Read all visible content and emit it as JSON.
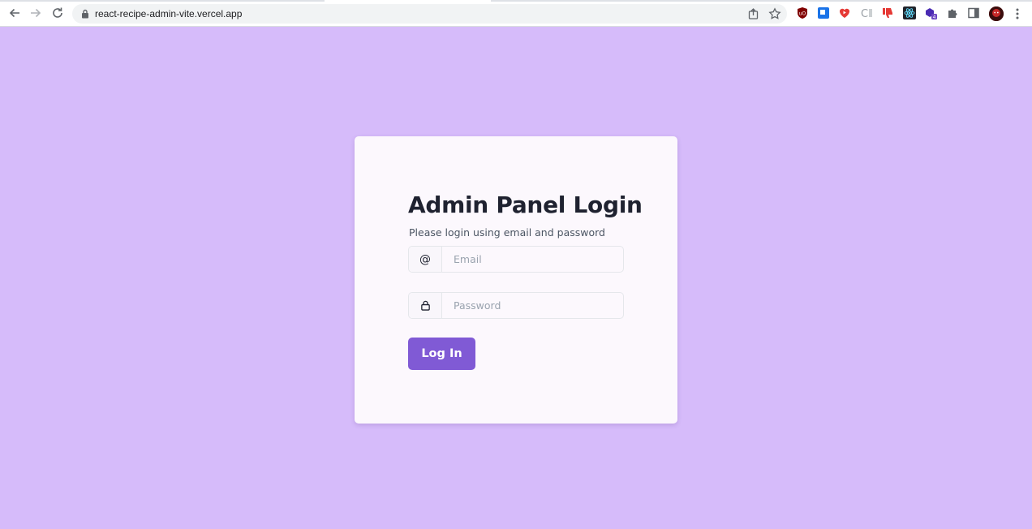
{
  "browser": {
    "url": "react-recipe-admin-vite.vercel.app"
  },
  "login": {
    "title": "Admin Panel Login",
    "subtitle": "Please login using email and password",
    "email_icon": "@",
    "email_placeholder": "Email",
    "password_placeholder": "Password",
    "submit_label": "Log In"
  },
  "extensions": {
    "badge_count": "4"
  },
  "colors": {
    "page_background": "#d6bbfa",
    "card_background": "#fcf8fd",
    "button": "#805ad5",
    "title_text": "#1f2230"
  }
}
